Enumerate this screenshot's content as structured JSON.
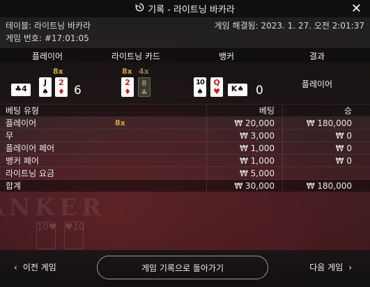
{
  "window": {
    "title": "기록 - 라이트닝 바카라",
    "history_icon": "history-icon",
    "close_icon": "close-icon",
    "close_glyph": "✕"
  },
  "info": {
    "table_label": "테이블: 라이트닝 바카라",
    "settled_label": "게임 해결됨: 2023. 1. 27. 오전 2:01:37",
    "game_no_label": "게임 번호: #17:01:05"
  },
  "columns": {
    "player": "플레이어",
    "lightning_cards": "라이트닝 카드",
    "banker": "뱅커",
    "result": "결과"
  },
  "round": {
    "player_cards": [
      {
        "rank": "J",
        "suit": "♠",
        "color": "black"
      },
      {
        "rank": "2",
        "suit": "♦",
        "color": "red"
      }
    ],
    "player_side_card": {
      "rank": "4",
      "suit": "♣",
      "color": "black"
    },
    "player_multiplier": "8x",
    "player_score": "6",
    "lightning_cards": [
      {
        "rank": "2",
        "suit": "♦",
        "color": "red",
        "multiplier": "8x",
        "active": true
      },
      {
        "rank": "8",
        "suit": "♣",
        "color": "black",
        "multiplier": "4x",
        "active": false
      }
    ],
    "banker_cards": [
      {
        "rank": "10",
        "suit": "♠",
        "color": "black"
      },
      {
        "rank": "Q",
        "suit": "♥",
        "color": "red"
      }
    ],
    "banker_side_card": {
      "rank": "K",
      "suit": "♠",
      "color": "black"
    },
    "banker_score": "0",
    "winner": "플레이어"
  },
  "bets": {
    "headers": {
      "type": "베팅 유형",
      "bet": "베팅",
      "win": "승"
    },
    "rows": [
      {
        "type": "플레이어",
        "multiplier": "8x",
        "bet": "₩ 20,000",
        "win": "₩ 180,000"
      },
      {
        "type": "무",
        "multiplier": "",
        "bet": "₩ 3,000",
        "win": "₩ 0"
      },
      {
        "type": "플레이어 페어",
        "multiplier": "",
        "bet": "₩ 1,000",
        "win": "₩ 0"
      },
      {
        "type": "뱅커 페어",
        "multiplier": "",
        "bet": "₩ 1,000",
        "win": "₩ 0"
      },
      {
        "type": "라이트닝 요금",
        "multiplier": "",
        "bet": "₩ 5,000",
        "win": ""
      }
    ],
    "total": {
      "type": "합계",
      "bet": "₩ 30,000",
      "win": "₩ 180,000"
    }
  },
  "footer": {
    "prev_label": "이전 게임",
    "back_label": "게임 기록으로 돌아가기",
    "next_label": "다음 게임",
    "prev_glyph": "‹",
    "next_glyph": "›"
  },
  "colors": {
    "multiplier_gold": "#d8a638",
    "card_red": "#d01818",
    "header_bg": "#101010"
  }
}
